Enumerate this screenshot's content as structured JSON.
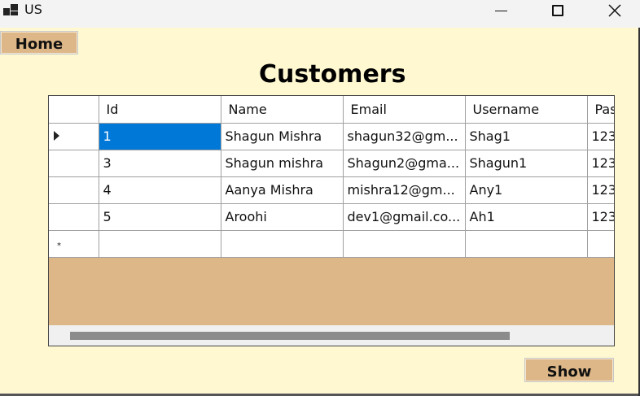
{
  "window": {
    "title": "US"
  },
  "nav": {
    "home_label": "Home"
  },
  "page": {
    "title": "Customers"
  },
  "table": {
    "columns": [
      "Id",
      "Name",
      "Email",
      "Username",
      "Pas"
    ],
    "rows": [
      [
        "1",
        "Shagun Mishra",
        "shagun32@gm...",
        "Shag1",
        "123"
      ],
      [
        "3",
        "Shagun mishra",
        "Shagun2@gma...",
        "Shagun1",
        "123"
      ],
      [
        "4",
        "Aanya Mishra",
        "mishra12@gm...",
        "Any1",
        "123"
      ],
      [
        "5",
        "Aroohi",
        "dev1@gmail.co...",
        "Ah1",
        "123"
      ]
    ],
    "current_row_indicator": "▸",
    "new_row_indicator": "*"
  },
  "actions": {
    "show_label": "Show"
  },
  "colors": {
    "background": "#fff8d0",
    "accent": "#ddb787",
    "selection": "#0078d7"
  },
  "icons": {
    "app": "app-window-icon",
    "minimize": "minimize-icon",
    "maximize": "maximize-icon",
    "close": "close-icon"
  }
}
